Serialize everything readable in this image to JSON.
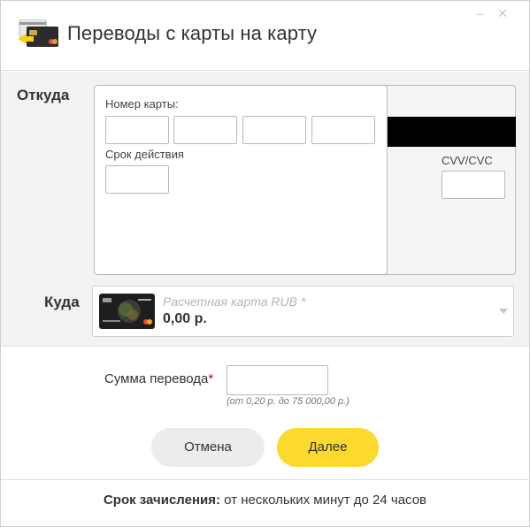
{
  "header": {
    "title": "Переводы с карты на карту",
    "icon": "cards-icon",
    "controls": {
      "minimize": "‒",
      "close": "✕"
    }
  },
  "from": {
    "label": "Откуда",
    "card_number_label": "Номер карты:",
    "card_number_values": [
      "",
      "",
      "",
      ""
    ],
    "expiry_label": "Срок действия",
    "expiry_value": "",
    "cvv_label": "CVV/CVC",
    "cvv_value": ""
  },
  "to": {
    "label": "Куда",
    "placeholder": "Расчетная карта RUB *",
    "amount": "0,00 р."
  },
  "transfer": {
    "label": "Сумма перевода",
    "required_mark": "*",
    "value": "",
    "hint": "(от 0,20 р. до 75 000,00 р.)"
  },
  "buttons": {
    "cancel": "Отмена",
    "next": "Далее"
  },
  "footer": {
    "label": "Срок зачисления:",
    "text": " от нескольких минут до 24 часов"
  },
  "colors": {
    "accent": "#fcd92d",
    "required": "#d0021b",
    "panel_bg": "#f2f2f2"
  }
}
